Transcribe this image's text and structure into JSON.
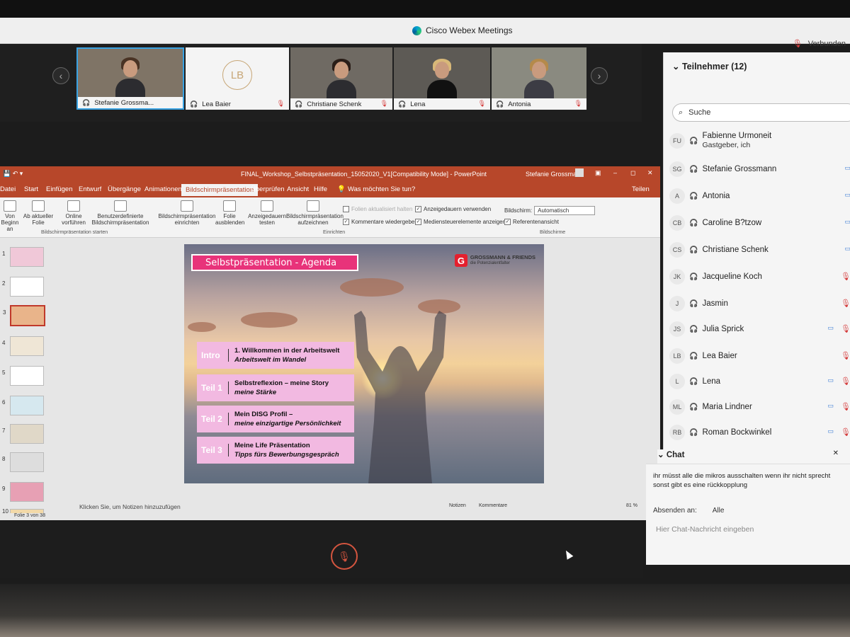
{
  "window": {
    "title": "Cisco Webex Meetings",
    "status": "Verbunden"
  },
  "tiles": [
    {
      "name": "Stefanie Grossma...",
      "muted": false
    },
    {
      "name": "Lea Baier",
      "initials": "LB",
      "muted": true
    },
    {
      "name": "Christiane Schenk",
      "muted": true
    },
    {
      "name": "Lena",
      "muted": true
    },
    {
      "name": "Antonia",
      "muted": true
    }
  ],
  "ppt": {
    "title": "FINAL_Workshop_Selbstpräsentation_15052020_V1[Compatibility Mode] - PowerPoint",
    "user": "Stefanie Grossmann",
    "tabs": [
      "Datei",
      "Start",
      "Einfügen",
      "Entwurf",
      "Übergänge",
      "Animationen",
      "Bildschirmpräsentation",
      "Überprüfen",
      "Ansicht",
      "Hilfe"
    ],
    "tell_me": "Was möchten Sie tun?",
    "share": "Teilen",
    "ribbon": {
      "btn_from_start": "Von Beginn an",
      "btn_from_current": "Ab aktueller Folie",
      "btn_online": "Online vorführen",
      "btn_custom": "Benutzerdefinierte Bildschirmpräsentation",
      "group_start": "Bildschirmpräsentation starten",
      "btn_setup": "Bildschirmpräsentation einrichten",
      "btn_hide": "Folie ausblenden",
      "btn_rehearse": "Anzeigedauern testen",
      "btn_record": "Bildschirmpräsentation aufzeichnen",
      "chk_update": "Folien aktualisiert halten",
      "chk_comments": "Kommentare wiedergeben",
      "chk_timings": "Anzeigedauern verwenden",
      "chk_media": "Mediensteuerelemente anzeigen",
      "group_setup": "Einrichten",
      "monitor_label": "Bildschirm:",
      "monitor_value": "Automatisch",
      "chk_presenter": "Referentenansicht",
      "group_monitors": "Bildschirme"
    },
    "thumb_numbers": [
      "1",
      "2",
      "3",
      "4",
      "5",
      "6",
      "7",
      "8",
      "9",
      "10"
    ],
    "selected_slide": 3,
    "notes_placeholder": "Klicken Sie, um Notizen hinzuzufügen",
    "status_slide": "Folie 3 von 38",
    "status_notes": "Notizen",
    "status_comments": "Kommentare",
    "zoom": "81 %"
  },
  "slide": {
    "title": "Selbstpräsentation - Agenda",
    "brand_name": "GROSSMANN & FRIENDS",
    "brand_sub": "die Potenzialentfalter",
    "items": [
      {
        "label": "Intro",
        "line1": "1. Willkommen in der Arbeitswelt",
        "line2": "Arbeitswelt im Wandel"
      },
      {
        "label": "Teil 1",
        "line1": "Selbstreflexion – meine Story",
        "line2": "meine Stärke"
      },
      {
        "label": "Teil 2",
        "line1": "Mein DISG Profil –",
        "line2": "meine einzigartige Persönlichkeit"
      },
      {
        "label": "Teil 3",
        "line1": "Meine Life Präsentation",
        "line2": "Tipps fürs Bewerbungsgespräch"
      }
    ]
  },
  "participants": {
    "header": "Teilnehmer (12)",
    "search_placeholder": "Suche",
    "list": [
      {
        "initials": "FU",
        "name": "Fabienne Urmoneit",
        "role": "Gastgeber, ich",
        "video": false,
        "muted": false
      },
      {
        "initials": "SG",
        "name": "Stefanie Grossmann",
        "role": "",
        "video": true,
        "muted": false
      },
      {
        "initials": "A",
        "name": "Antonia",
        "role": "",
        "video": true,
        "muted": false
      },
      {
        "initials": "CB",
        "name": "Caroline B?tzow",
        "role": "",
        "video": true,
        "muted": false
      },
      {
        "initials": "CS",
        "name": "Christiane Schenk",
        "role": "",
        "video": true,
        "muted": false
      },
      {
        "initials": "JK",
        "name": "Jacqueline Koch",
        "role": "",
        "video": false,
        "muted": true
      },
      {
        "initials": "J",
        "name": "Jasmin",
        "role": "",
        "video": false,
        "muted": true
      },
      {
        "initials": "JS",
        "name": "Julia Sprick",
        "role": "",
        "video": true,
        "muted": true
      },
      {
        "initials": "LB",
        "name": "Lea Baier",
        "role": "",
        "video": false,
        "muted": true
      },
      {
        "initials": "L",
        "name": "Lena",
        "role": "",
        "video": true,
        "muted": true
      },
      {
        "initials": "ML",
        "name": "Maria Lindner",
        "role": "",
        "video": true,
        "muted": true
      },
      {
        "initials": "RB",
        "name": "Roman Bockwinkel",
        "role": "",
        "video": true,
        "muted": true
      }
    ]
  },
  "chat": {
    "header": "Chat",
    "message": "ihr müsst alle die mikros ausschalten wenn ihr nicht sprecht sonst gibt es eine rückkopplung",
    "send_to_label": "Absenden an:",
    "send_to_value": "Alle",
    "input_placeholder": "Hier Chat-Nachricht eingeben"
  },
  "colors": {
    "ppt_red": "#b7472a",
    "slide_pink": "#e8337a",
    "agenda_pink": "#f2b9e1",
    "mute_red": "#d4553f"
  }
}
